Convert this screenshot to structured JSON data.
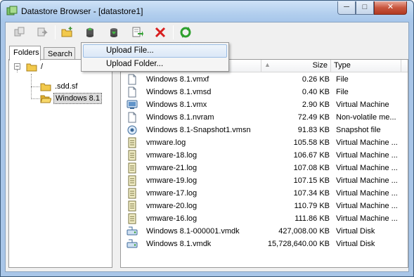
{
  "window": {
    "title": "Datastore Browser - [datastore1]",
    "minimize_label": "─",
    "maximize_label": "□",
    "close_label": "✕"
  },
  "toolbar": {
    "buttons": [
      "copy-icon",
      "move-icon",
      "new-folder-icon",
      "upload-icon",
      "download-icon",
      "add-inventory-icon",
      "delete-icon",
      "refresh-icon"
    ]
  },
  "menu": {
    "items": [
      "Upload File...",
      "Upload Folder..."
    ],
    "highlighted": "Upload File..."
  },
  "left_panel": {
    "tabs": [
      "Folders",
      "Search"
    ],
    "active_tab": "Folders",
    "tree": {
      "expander": "−",
      "root": "/",
      "children": [
        ".sdd.sf",
        "Windows 8.1"
      ],
      "selected": "Windows 8.1"
    }
  },
  "list": {
    "columns": [
      "Name",
      "Size",
      "Type"
    ],
    "rows": [
      {
        "icon": "file-icon",
        "name": "Windows 8.1.vmxf",
        "size": "0.26 KB",
        "type": "File"
      },
      {
        "icon": "file-icon",
        "name": "Windows 8.1.vmsd",
        "size": "0.40 KB",
        "type": "File"
      },
      {
        "icon": "vm-icon",
        "name": "Windows 8.1.vmx",
        "size": "2.90 KB",
        "type": "Virtual Machine"
      },
      {
        "icon": "file-icon",
        "name": "Windows 8.1.nvram",
        "size": "72.49 KB",
        "type": "Non-volatile me..."
      },
      {
        "icon": "snapshot-icon",
        "name": "Windows 8.1-Snapshot1.vmsn",
        "size": "91.83 KB",
        "type": "Snapshot file"
      },
      {
        "icon": "log-icon",
        "name": "vmware.log",
        "size": "105.58 KB",
        "type": "Virtual Machine ..."
      },
      {
        "icon": "log-icon",
        "name": "vmware-18.log",
        "size": "106.67 KB",
        "type": "Virtual Machine ..."
      },
      {
        "icon": "log-icon",
        "name": "vmware-21.log",
        "size": "107.08 KB",
        "type": "Virtual Machine ..."
      },
      {
        "icon": "log-icon",
        "name": "vmware-19.log",
        "size": "107.15 KB",
        "type": "Virtual Machine ..."
      },
      {
        "icon": "log-icon",
        "name": "vmware-17.log",
        "size": "107.34 KB",
        "type": "Virtual Machine ..."
      },
      {
        "icon": "log-icon",
        "name": "vmware-20.log",
        "size": "110.79 KB",
        "type": "Virtual Machine ..."
      },
      {
        "icon": "log-icon",
        "name": "vmware-16.log",
        "size": "111.86 KB",
        "type": "Virtual Machine ..."
      },
      {
        "icon": "disk-icon",
        "name": "Windows 8.1-000001.vmdk",
        "size": "427,008.00 KB",
        "type": "Virtual Disk"
      },
      {
        "icon": "disk-icon",
        "name": "Windows 8.1.vmdk",
        "size": "15,728,640.00 KB",
        "type": "Virtual Disk"
      }
    ]
  },
  "colors": {
    "title_bar": "#b3cfee",
    "close_button": "#c8553d",
    "folder": "#f0c040",
    "delete": "#d81e1e",
    "refresh": "#2ea02e",
    "menu_highlight": "#dbe8f7"
  }
}
